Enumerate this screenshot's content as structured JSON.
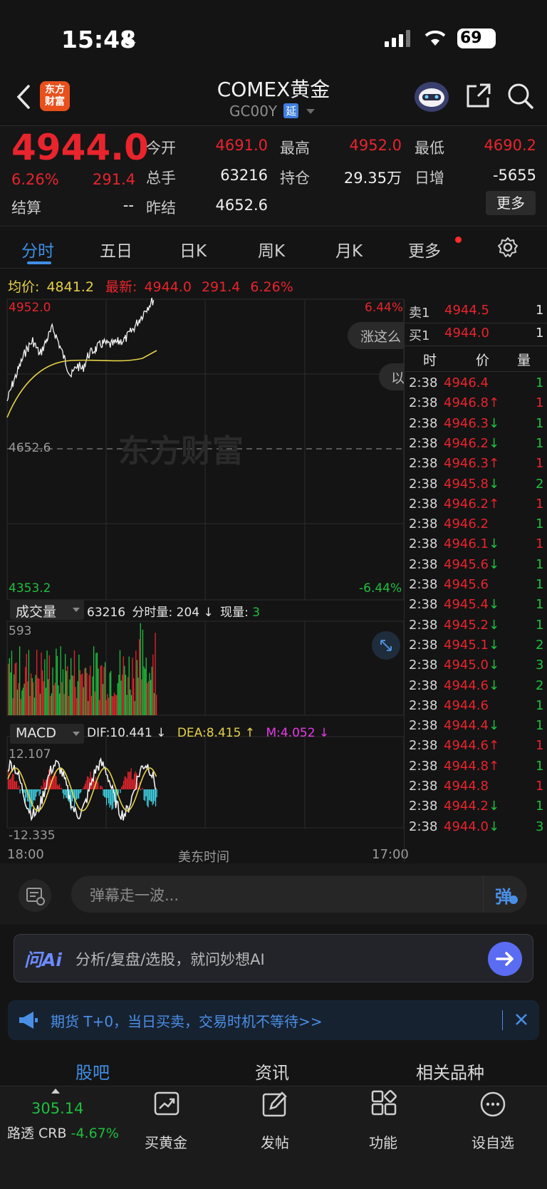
{
  "status_bar": {
    "time": "15:48",
    "battery": "69"
  },
  "nav": {
    "logo_text_line1": "东方",
    "logo_text_line2": "财富",
    "title": "COMEX黄金",
    "code": "GC00Y",
    "delay_badge": "延"
  },
  "quote": {
    "last": "4944.0",
    "change_pct": "6.26%",
    "change": "291.4",
    "settle_label": "结算",
    "settle_value": "--",
    "open_label": "今开",
    "open_value": "4691.0",
    "high_label": "最高",
    "high_value": "4952.0",
    "low_label": "最低",
    "low_value": "4690.2",
    "volume_label": "总手",
    "volume_value": "63216",
    "oi_label": "持仓",
    "oi_value": "29.35万",
    "daily_add_label": "日增",
    "daily_add_value": "-5655",
    "prev_settle_label": "昨结",
    "prev_settle_value": "4652.6",
    "more_label": "更多"
  },
  "tabs": [
    "分时",
    "五日",
    "日K",
    "周K",
    "月K",
    "更多"
  ],
  "chart_header": {
    "avg_label": "均价:",
    "avg_value": "4841.2",
    "last_label": "最新:",
    "last_value": "4944.0",
    "chg": "291.4",
    "pct": "6.26%"
  },
  "chart_data": {
    "type": "line",
    "title": "",
    "ylim": [
      4353.2,
      4952.0
    ],
    "y_top_label": "4952.0",
    "y_mid_label": "4652.6",
    "y_bottom_label": "4353.2",
    "pct_top": "6.44%",
    "pct_bottom": "-6.44%",
    "x_start": "18:00",
    "x_mid": "美东时间",
    "x_end": "17:00",
    "watermark": "东方财富",
    "bubble1": "涨这么",
    "bubble2": "以",
    "volume_panel": {
      "selector": "成交量",
      "total": "63216",
      "tick_label": "分时量:",
      "tick_value": "204 ↓",
      "now_label": "现量:",
      "now_value": "3",
      "ymax": "593"
    },
    "macd_panel": {
      "selector": "MACD",
      "dif": "DIF:10.441 ↓",
      "dea": "DEA:8.415 ↑",
      "m": "M:4.052 ↓",
      "ymax": "12.107",
      "ymin": "-12.335"
    }
  },
  "order_book": {
    "ask_label": "卖1",
    "ask_price": "4944.5",
    "ask_qty": "1",
    "bid_label": "买1",
    "bid_price": "4944.0",
    "bid_qty": "1",
    "head_time": "时",
    "head_price": "价",
    "head_qty": "量"
  },
  "trades": [
    {
      "t": "2:38",
      "p": "4946.4",
      "a": "",
      "q": "1",
      "qc": "green"
    },
    {
      "t": "2:38",
      "p": "4946.8",
      "a": "↑",
      "q": "1",
      "qc": "red"
    },
    {
      "t": "2:38",
      "p": "4946.3",
      "a": "↓",
      "q": "1",
      "qc": "green"
    },
    {
      "t": "2:38",
      "p": "4946.2",
      "a": "↓",
      "q": "1",
      "qc": "green"
    },
    {
      "t": "2:38",
      "p": "4946.3",
      "a": "↑",
      "q": "1",
      "qc": "red"
    },
    {
      "t": "2:38",
      "p": "4945.8",
      "a": "↓",
      "q": "2",
      "qc": "green"
    },
    {
      "t": "2:38",
      "p": "4946.2",
      "a": "↑",
      "q": "1",
      "qc": "red"
    },
    {
      "t": "2:38",
      "p": "4946.2",
      "a": "",
      "q": "1",
      "qc": "green"
    },
    {
      "t": "2:38",
      "p": "4946.1",
      "a": "↓",
      "q": "1",
      "qc": "red"
    },
    {
      "t": "2:38",
      "p": "4945.6",
      "a": "↓",
      "q": "1",
      "qc": "green"
    },
    {
      "t": "2:38",
      "p": "4945.6",
      "a": "",
      "q": "1",
      "qc": "green"
    },
    {
      "t": "2:38",
      "p": "4945.4",
      "a": "↓",
      "q": "1",
      "qc": "green"
    },
    {
      "t": "2:38",
      "p": "4945.2",
      "a": "↓",
      "q": "1",
      "qc": "green"
    },
    {
      "t": "2:38",
      "p": "4945.1",
      "a": "↓",
      "q": "2",
      "qc": "green"
    },
    {
      "t": "2:38",
      "p": "4945.0",
      "a": "↓",
      "q": "3",
      "qc": "green"
    },
    {
      "t": "2:38",
      "p": "4944.6",
      "a": "↓",
      "q": "2",
      "qc": "green"
    },
    {
      "t": "2:38",
      "p": "4944.6",
      "a": "",
      "q": "1",
      "qc": "green"
    },
    {
      "t": "2:38",
      "p": "4944.4",
      "a": "↓",
      "q": "1",
      "qc": "green"
    },
    {
      "t": "2:38",
      "p": "4944.6",
      "a": "↑",
      "q": "1",
      "qc": "red"
    },
    {
      "t": "2:38",
      "p": "4944.8",
      "a": "↑",
      "q": "1",
      "qc": "green"
    },
    {
      "t": "2:38",
      "p": "4944.8",
      "a": "",
      "q": "1",
      "qc": "red"
    },
    {
      "t": "2:38",
      "p": "4944.2",
      "a": "↓",
      "q": "1",
      "qc": "green"
    },
    {
      "t": "2:38",
      "p": "4944.0",
      "a": "↓",
      "q": "3",
      "qc": "green"
    }
  ],
  "danmu": {
    "placeholder": "弹幕走一波...",
    "button": "弹"
  },
  "ai": {
    "logo": "问Ai",
    "placeholder": "分析/复盘/选股，就问妙想AI"
  },
  "promo": {
    "text": "期货 T+0，当日买卖，交易时机不等待>>"
  },
  "bottom_tabs": [
    "股吧",
    "资讯",
    "相关品种"
  ],
  "dock": {
    "ticker_price": "305.14",
    "ticker_name": "路透 CRB",
    "ticker_pct": "-4.67%",
    "items": [
      "买黄金",
      "发帖",
      "功能",
      "设自选"
    ]
  },
  "colors": {
    "up": "#e8242d",
    "down": "#1fbf3f",
    "accent": "#3f8fe6",
    "avg": "#e5d148"
  }
}
